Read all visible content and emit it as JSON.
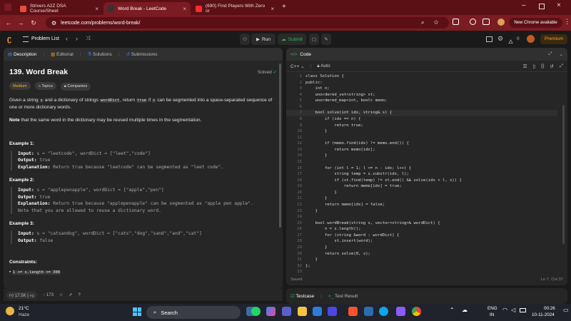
{
  "browser": {
    "tabs": [
      {
        "title": "Strivers A2Z DSA Course/Sheet"
      },
      {
        "title": "Word Break - LeetCode"
      },
      {
        "title": "(690) Find Players With Zero or"
      }
    ],
    "url": "leetcode.com/problems/word-break/",
    "new_chrome_label": "New Chrome available",
    "colors": {
      "frame": "#5b1016",
      "active_tab": "#7a1c22"
    }
  },
  "lc_header": {
    "problem_list": "Problem List",
    "run": "Run",
    "submit": "Submit",
    "coins": "0",
    "premium": "Premium"
  },
  "left": {
    "tabs": [
      "Description",
      "Editorial",
      "Solutions",
      "Submissions"
    ],
    "title": "139. Word Break",
    "status": "Solved",
    "tags": [
      "Medium",
      "Topics",
      "Companies"
    ],
    "desc_p1": {
      "a": "Given a string ",
      "s1": "s",
      "b": " and a dictionary of strings ",
      "wd": "wordDict",
      "c": ", return ",
      "tr": "true",
      "d": " if ",
      "s2": "s",
      "e": " can be segmented into a space-separated sequence of one or more dictionary words."
    },
    "note": {
      "bold": "Note",
      "text": " that the same word in the dictionary may be reused multiple times in the segmentation."
    },
    "examples": [
      {
        "title": "Example 1:",
        "input": "s = \"leetcode\", wordDict = [\"leet\",\"code\"]",
        "output": "true",
        "explanation": "Return true because \"leetcode\" can be segmented as \"leet code\"."
      },
      {
        "title": "Example 2:",
        "input": "s = \"applepenapple\", wordDict = [\"apple\",\"pen\"]",
        "output": "true",
        "explanation": "Return true because \"applepenapple\" can be segmented as \"apple pen apple\".",
        "explanation2": "Note that you are allowed to reuse a dictionary word."
      },
      {
        "title": "Example 3:",
        "input": "s = \"catsandog\", wordDict = [\"cats\",\"dog\",\"sand\",\"and\",\"cat\"]",
        "output": "false"
      }
    ],
    "labels": {
      "input": "Input:",
      "output": "Output:",
      "explanation": "Explanation:"
    },
    "constraints_title": "Constraints:",
    "constraint1": "1 <= s.length <= 300",
    "likes": "17.5K",
    "comments": "173"
  },
  "right": {
    "title": "Code",
    "language": "C++",
    "auto": "Auto",
    "saved": "Saved",
    "cursor": "Ln 7, Col 37",
    "code_lines": [
      "class Solution {",
      "public:",
      "    int n;",
      "    unordered_set<string> st;",
      "    unordered_map<int, bool> memo;",
      "",
      "    bool solve(int idx, string& s) {",
      "        if (idx == n) {",
      "            return true;",
      "        }",
      "",
      "        if (memo.find(idx) != memo.end()) {",
      "            return memo[idx];",
      "        }",
      "",
      "        for (int l = 1; l <= n - idx; l++) {",
      "            string temp = s.substr(idx, l);",
      "            if (st.find(temp) != st.end() && solve(idx + l, s)) {",
      "                return memo[idx] = true;",
      "            }",
      "        }",
      "        return memo[idx] = false;",
      "    }",
      "",
      "    bool wordBreak(string s, vector<string>& wordDict) {",
      "        n = s.length();",
      "        for (string &word : wordDict) {",
      "            st.insert(word);",
      "        }",
      "        return solve(0, s);",
      "    }",
      "};",
      ""
    ],
    "testcase": "Testcase",
    "test_result": "Test Result"
  },
  "taskbar": {
    "weather_temp": "21°C",
    "weather_desc": "Haze",
    "search": "Search",
    "lang1": "ENG",
    "lang2": "IN",
    "time": "00:26",
    "date": "10-11-2024"
  }
}
